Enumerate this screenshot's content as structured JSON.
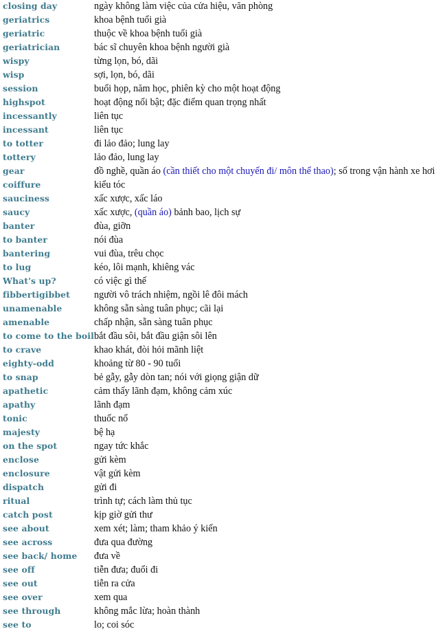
{
  "colors": {
    "term": "#3f7b8e",
    "meaning": "#111111",
    "highlight": "#1a17b4",
    "background": "#ffffff"
  },
  "entries": [
    {
      "term": "closing day",
      "meaning": [
        {
          "text": "ngày không làm việc của cửa hiệu, văn phòng"
        }
      ]
    },
    {
      "term": "geriatrics",
      "meaning": [
        {
          "text": "khoa bệnh tuổi già"
        }
      ]
    },
    {
      "term": "geriatric",
      "meaning": [
        {
          "text": "thuộc về khoa bệnh tuổi già"
        }
      ]
    },
    {
      "term": "geriatrician",
      "meaning": [
        {
          "text": "bác sĩ chuyên khoa bệnh người già"
        }
      ]
    },
    {
      "term": "wispy",
      "meaning": [
        {
          "text": "từng lọn, bó, dãi"
        }
      ]
    },
    {
      "term": "wisp",
      "meaning": [
        {
          "text": "sợi, lọn, bó, dãi"
        }
      ]
    },
    {
      "term": "session",
      "meaning": [
        {
          "text": "buổi họp, năm học, phiên kỳ cho một hoạt động"
        }
      ]
    },
    {
      "term": "highspot",
      "meaning": [
        {
          "text": "hoạt động nổi bật; đặc điểm quan trọng nhất"
        }
      ]
    },
    {
      "term": "incessantly",
      "meaning": [
        {
          "text": "liên tục"
        }
      ]
    },
    {
      "term": "incessant",
      "meaning": [
        {
          "text": "liên tục"
        }
      ]
    },
    {
      "term": "to totter",
      "meaning": [
        {
          "text": "đi lảo đảo; lung lay"
        }
      ]
    },
    {
      "term": "tottery",
      "meaning": [
        {
          "text": "lảo đảo, lung lay"
        }
      ]
    },
    {
      "term": "gear",
      "meaning": [
        {
          "text": "đồ nghề, quần áo "
        },
        {
          "text": "(cần thiết cho một chuyến đi/ môn thể thao)",
          "hl": true
        },
        {
          "text": "; số trong vận hành xe hơi"
        }
      ]
    },
    {
      "term": "coiffure",
      "meaning": [
        {
          "text": "kiểu tóc"
        }
      ]
    },
    {
      "term": "sauciness",
      "meaning": [
        {
          "text": "xấc xược, xấc láo"
        }
      ]
    },
    {
      "term": "saucy",
      "meaning": [
        {
          "text": "xấc xược, "
        },
        {
          "text": "(quần áo)",
          "hl": true
        },
        {
          "text": " bảnh bao, lịch sự"
        }
      ]
    },
    {
      "term": "banter",
      "meaning": [
        {
          "text": "đùa, giỡn"
        }
      ]
    },
    {
      "term": "to banter",
      "meaning": [
        {
          "text": "nói đùa"
        }
      ]
    },
    {
      "term": "bantering",
      "meaning": [
        {
          "text": "vui đùa, trêu chọc"
        }
      ]
    },
    {
      "term": "to lug",
      "meaning": [
        {
          "text": "kéo, lôi mạnh, khiêng vác"
        }
      ]
    },
    {
      "term": "What's up?",
      "meaning": [
        {
          "text": "có việc gì thế"
        }
      ]
    },
    {
      "term": "fibbertigibbet",
      "meaning": [
        {
          "text": "người vô trách nhiệm, ngồi lê đôi mách"
        }
      ]
    },
    {
      "term": "unamenable",
      "meaning": [
        {
          "text": "không sẵn sàng tuân phục; cãi lại"
        }
      ]
    },
    {
      "term": "amenable",
      "meaning": [
        {
          "text": "chấp nhận, sẵn sàng tuân phục"
        }
      ]
    },
    {
      "term": "to come to the boil",
      "meaning": [
        {
          "text": "bắt đầu sôi, bắt đầu giận sôi lên"
        }
      ]
    },
    {
      "term": "to crave",
      "meaning": [
        {
          "text": "khao khát, đòi hỏi mãnh liệt"
        }
      ]
    },
    {
      "term": "eighty-odd",
      "meaning": [
        {
          "text": "khoảng từ 80 - 90 tuổi"
        }
      ]
    },
    {
      "term": "to snap",
      "meaning": [
        {
          "text": "bẻ gẫy, gẫy dòn tan; nói với giọng giận dữ"
        }
      ]
    },
    {
      "term": "apathetic",
      "meaning": [
        {
          "text": "cảm thấy lãnh đạm, không cảm xúc"
        }
      ]
    },
    {
      "term": "apathy",
      "meaning": [
        {
          "text": "lãnh đạm"
        }
      ]
    },
    {
      "term": "tonic",
      "meaning": [
        {
          "text": "thuốc nổ"
        }
      ]
    },
    {
      "term": "majesty",
      "meaning": [
        {
          "text": "bệ hạ"
        }
      ]
    },
    {
      "term": "on the spot",
      "meaning": [
        {
          "text": "ngay tức khắc"
        }
      ]
    },
    {
      "term": "enclose",
      "meaning": [
        {
          "text": "gửi kèm"
        }
      ]
    },
    {
      "term": "enclosure",
      "meaning": [
        {
          "text": "vật gửi kèm"
        }
      ]
    },
    {
      "term": "dispatch",
      "meaning": [
        {
          "text": "gửi đi"
        }
      ]
    },
    {
      "term": "ritual",
      "meaning": [
        {
          "text": "trình tự; cách làm thủ tục"
        }
      ]
    },
    {
      "term": "catch post",
      "meaning": [
        {
          "text": "kịp giờ gửi thư"
        }
      ]
    },
    {
      "term": "see about",
      "meaning": [
        {
          "text": "xem xét; làm; tham khảo ý kiến"
        }
      ]
    },
    {
      "term": "see across",
      "meaning": [
        {
          "text": "đưa qua đường"
        }
      ]
    },
    {
      "term": "see back/ home",
      "meaning": [
        {
          "text": "đưa về"
        }
      ]
    },
    {
      "term": "see off",
      "meaning": [
        {
          "text": "tiễn đưa; đuổi đi"
        }
      ]
    },
    {
      "term": "see out",
      "meaning": [
        {
          "text": "tiễn ra cửa"
        }
      ]
    },
    {
      "term": "see over",
      "meaning": [
        {
          "text": "xem qua"
        }
      ]
    },
    {
      "term": "see through",
      "meaning": [
        {
          "text": "không mắc lừa; hoàn thành"
        }
      ]
    },
    {
      "term": "see to",
      "meaning": [
        {
          "text": "lo; coi sóc"
        }
      ]
    }
  ]
}
